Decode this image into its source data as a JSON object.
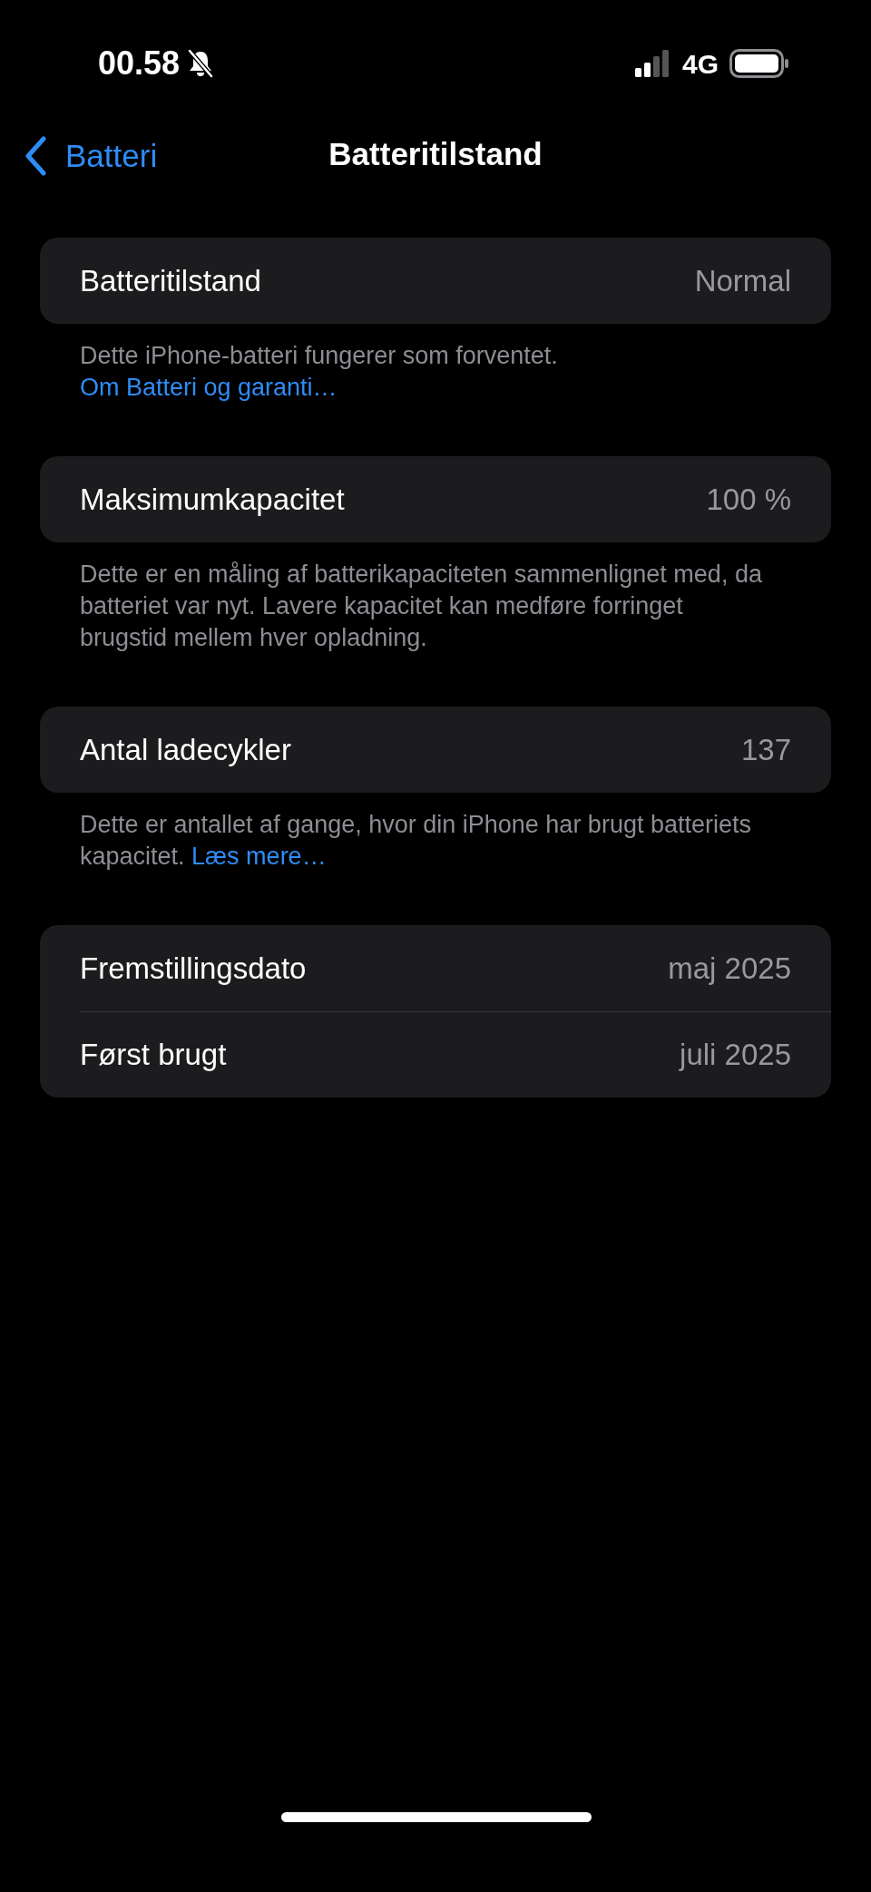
{
  "status_bar": {
    "time": "00.58",
    "silent": true,
    "network": "4G"
  },
  "nav": {
    "back_label": "Batteri",
    "title": "Batteritilstand"
  },
  "sections": [
    {
      "rows": [
        {
          "label": "Batteritilstand",
          "value": "Normal"
        }
      ],
      "footer": {
        "text": "Dette iPhone-batteri fungerer som forventet.",
        "link": "Om Batteri og garanti…"
      }
    },
    {
      "rows": [
        {
          "label": "Maksimumkapacitet",
          "value": "100 %"
        }
      ],
      "footer": {
        "text": "Dette er en måling af batterikapaciteten sammenlignet med, da batteriet var nyt. Lavere kapacitet kan medføre forringet brugstid mellem hver opladning."
      }
    },
    {
      "rows": [
        {
          "label": "Antal ladecykler",
          "value": "137"
        }
      ],
      "footer": {
        "text": "Dette er antallet af gange, hvor din iPhone har brugt batteriets kapacitet.",
        "link": "Læs mere…"
      }
    },
    {
      "rows": [
        {
          "label": "Fremstillingsdato",
          "value": "maj 2025"
        },
        {
          "label": "Først brugt",
          "value": "juli 2025"
        }
      ]
    }
  ]
}
